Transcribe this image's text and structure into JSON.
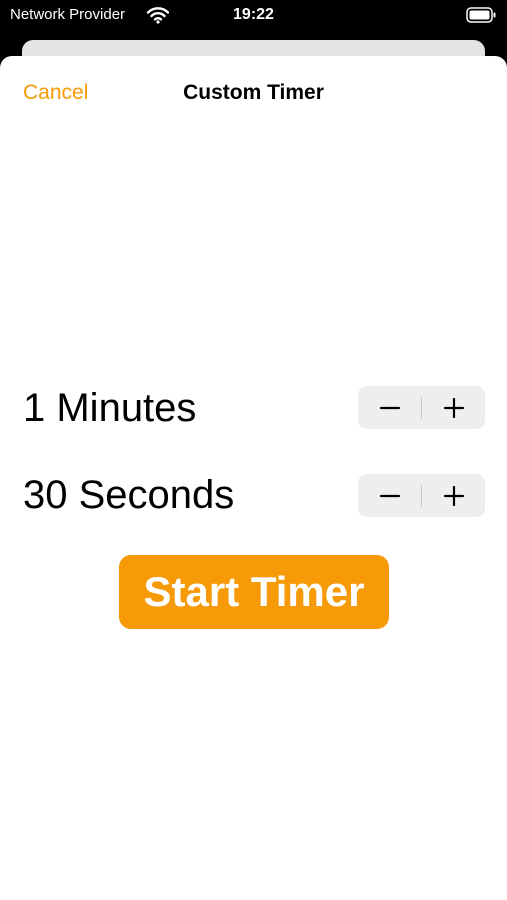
{
  "status_bar": {
    "carrier": "Network Provider",
    "time": "19:22",
    "icons": [
      "wifi-icon",
      "battery-icon"
    ]
  },
  "nav": {
    "cancel_label": "Cancel",
    "title": "Custom Timer"
  },
  "minutes": {
    "label": "1 Minutes",
    "minus_icon": "minus-icon",
    "plus_icon": "plus-icon"
  },
  "seconds": {
    "label": "30 Seconds",
    "minus_icon": "minus-icon",
    "plus_icon": "plus-icon"
  },
  "start_button_label": "Start Timer",
  "colors": {
    "accent": "#f69a08",
    "stepper_bg": "#eeeeef",
    "text": "#000000"
  }
}
